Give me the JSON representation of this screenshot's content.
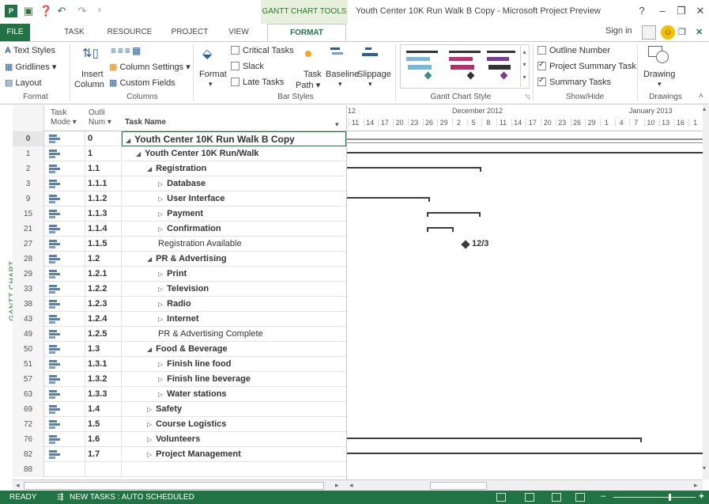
{
  "app": {
    "document_title": "Youth Center 10K Run Walk B Copy - Microsoft Project Preview",
    "context_tool": "GANTT CHART TOOLS",
    "window_controls": [
      "?",
      "–",
      "❐",
      "✕"
    ]
  },
  "tabs": [
    {
      "label": "FILE"
    },
    {
      "label": "TASK"
    },
    {
      "label": "RESOURCE"
    },
    {
      "label": "PROJECT"
    },
    {
      "label": "VIEW"
    },
    {
      "label": "FORMAT"
    }
  ],
  "account": {
    "signin": "Sign in"
  },
  "ribbon": {
    "format": {
      "text_styles": "Text Styles",
      "gridlines": "Gridlines",
      "layout": "Layout",
      "group": "Format"
    },
    "columns": {
      "insert_column_1": "Insert",
      "insert_column_2": "Column",
      "column_settings": "Column Settings",
      "custom_fields": "Custom Fields",
      "group": "Columns"
    },
    "bar_styles": {
      "format_label": "Format",
      "critical_tasks": "Critical Tasks",
      "slack": "Slack",
      "late_tasks": "Late Tasks",
      "task_path_1": "Task",
      "task_path_2": "Path",
      "baseline": "Baseline",
      "slippage": "Slippage",
      "group": "Bar Styles"
    },
    "gantt_chart_style": {
      "group": "Gantt Chart Style"
    },
    "show_hide": {
      "outline_number": "Outline Number",
      "project_summary_task": "Project Summary Task",
      "summary_tasks": "Summary Tasks",
      "group": "Show/Hide",
      "outline_number_checked": false,
      "project_summary_checked": true,
      "summary_checked": true
    },
    "drawings": {
      "drawing": "Drawing",
      "group": "Drawings"
    }
  },
  "view_label": "GANTT CHART",
  "sheet": {
    "headers": {
      "mode_1": "Task",
      "mode_2": "Mode",
      "wbs_1": "Outli",
      "wbs_2": "Num",
      "name": "Task Name"
    },
    "rows": [
      {
        "id": "0",
        "wbs": "0",
        "name": "Youth Center 10K Run Walk B Copy",
        "prefix": "◢",
        "level": 0,
        "bold": true
      },
      {
        "id": "1",
        "wbs": "1",
        "name": "Youth Center 10K Run/Walk",
        "prefix": "◢",
        "level": 1,
        "bold": true
      },
      {
        "id": "2",
        "wbs": "1.1",
        "name": "Registration",
        "prefix": "◢",
        "level": 2,
        "bold": true
      },
      {
        "id": "3",
        "wbs": "1.1.1",
        "name": "Database",
        "prefix": "▷",
        "level": 3,
        "bold": true
      },
      {
        "id": "9",
        "wbs": "1.1.2",
        "name": "User Interface",
        "prefix": "▷",
        "level": 3,
        "bold": true
      },
      {
        "id": "15",
        "wbs": "1.1.3",
        "name": "Payment",
        "prefix": "▷",
        "level": 3,
        "bold": true
      },
      {
        "id": "21",
        "wbs": "1.1.4",
        "name": "Confirmation",
        "prefix": "▷",
        "level": 3,
        "bold": true
      },
      {
        "id": "27",
        "wbs": "1.1.5",
        "name": "Registration Available",
        "prefix": "",
        "level": 3,
        "bold": false
      },
      {
        "id": "28",
        "wbs": "1.2",
        "name": "PR & Advertising",
        "prefix": "◢",
        "level": 2,
        "bold": true
      },
      {
        "id": "29",
        "wbs": "1.2.1",
        "name": "Print",
        "prefix": "▷",
        "level": 3,
        "bold": true
      },
      {
        "id": "33",
        "wbs": "1.2.2",
        "name": "Television",
        "prefix": "▷",
        "level": 3,
        "bold": true
      },
      {
        "id": "38",
        "wbs": "1.2.3",
        "name": "Radio",
        "prefix": "▷",
        "level": 3,
        "bold": true
      },
      {
        "id": "43",
        "wbs": "1.2.4",
        "name": "Internet",
        "prefix": "▷",
        "level": 3,
        "bold": true
      },
      {
        "id": "49",
        "wbs": "1.2.5",
        "name": "PR & Advertising Complete",
        "prefix": "",
        "level": 3,
        "bold": false
      },
      {
        "id": "50",
        "wbs": "1.3",
        "name": "Food & Beverage",
        "prefix": "◢",
        "level": 2,
        "bold": true
      },
      {
        "id": "51",
        "wbs": "1.3.1",
        "name": "Finish line food",
        "prefix": "▷",
        "level": 3,
        "bold": true
      },
      {
        "id": "57",
        "wbs": "1.3.2",
        "name": "Finish line beverage",
        "prefix": "▷",
        "level": 3,
        "bold": true
      },
      {
        "id": "63",
        "wbs": "1.3.3",
        "name": "Water stations",
        "prefix": "▷",
        "level": 3,
        "bold": true
      },
      {
        "id": "69",
        "wbs": "1.4",
        "name": "Safety",
        "prefix": "▷",
        "level": 2,
        "bold": true
      },
      {
        "id": "72",
        "wbs": "1.5",
        "name": "Course Logistics",
        "prefix": "▷",
        "level": 2,
        "bold": true
      },
      {
        "id": "76",
        "wbs": "1.6",
        "name": "Volunteers",
        "prefix": "▷",
        "level": 2,
        "bold": true
      },
      {
        "id": "82",
        "wbs": "1.7",
        "name": "Project Management",
        "prefix": "▷",
        "level": 2,
        "bold": true
      },
      {
        "id": "88",
        "wbs": "",
        "name": "",
        "prefix": "",
        "level": 0,
        "bold": false
      }
    ]
  },
  "timeline": {
    "leading_label": "12",
    "months": [
      "December 2012",
      "January 2013"
    ],
    "days": [
      "11",
      "14",
      "17",
      "20",
      "23",
      "26",
      "29",
      "2",
      "5",
      "8",
      "11",
      "14",
      "17",
      "20",
      "23",
      "26",
      "29",
      "1",
      "4",
      "7",
      "10",
      "13",
      "16",
      "1"
    ]
  },
  "milestone": {
    "label": "12/3"
  },
  "status": {
    "ready": "READY",
    "new_tasks": "NEW TASKS : AUTO SCHEDULED"
  },
  "colors": {
    "accent": "#217346",
    "bar": "#3b3b3b"
  }
}
